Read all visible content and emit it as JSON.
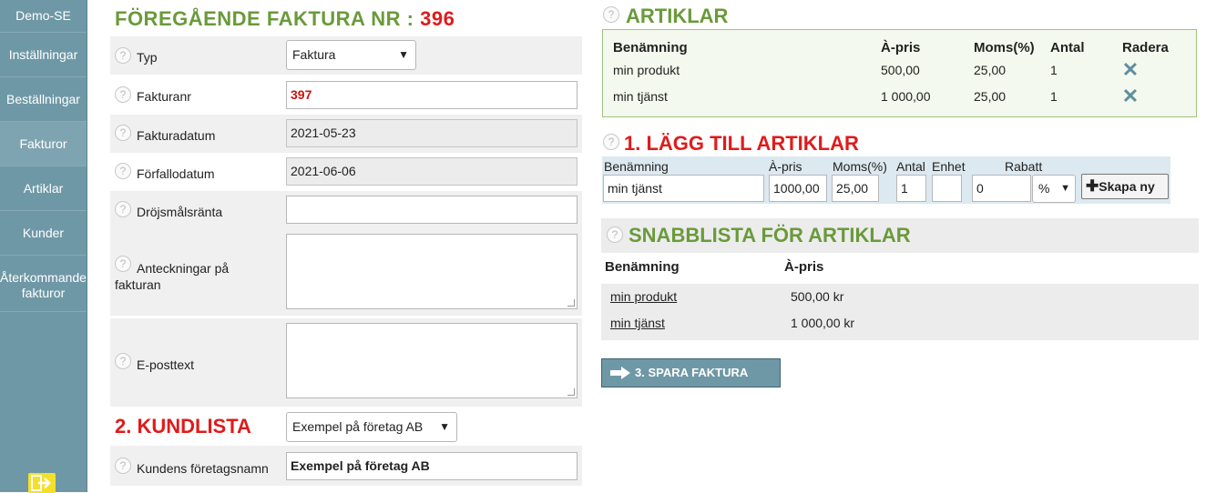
{
  "sidebar": {
    "items": [
      {
        "label": "Demo-SE"
      },
      {
        "label": "Inställningar"
      },
      {
        "label": "Beställningar"
      },
      {
        "label": "Fakturor"
      },
      {
        "label": "Artiklar"
      },
      {
        "label": "Kunder"
      },
      {
        "label": "Återkommande fakturor"
      }
    ],
    "active_index": 3
  },
  "invoice": {
    "heading_prefix": "FÖREGÅENDE FAKTURA NR :",
    "heading_number": "396",
    "help_glyph": "?",
    "fields": {
      "typ": {
        "label": "Typ",
        "value": "Faktura"
      },
      "fakturanr": {
        "label": "Fakturanr",
        "value": "397"
      },
      "fakturadatum": {
        "label": "Fakturadatum",
        "value": "2021-05-23"
      },
      "forfallodatum": {
        "label": "Förfallodatum",
        "value": "2021-06-06"
      },
      "drojsmalsranta": {
        "label": "Dröjsmålsränta",
        "value": ""
      },
      "anteckningar": {
        "label": "Anteckningar på fakturan",
        "value": ""
      },
      "eposttext": {
        "label": "E-posttext",
        "value": ""
      }
    }
  },
  "kundlista": {
    "heading": "2. KUNDLISTA",
    "selected": "Exempel på företag AB",
    "company_label": "Kundens företagsnamn",
    "company_value": "Exempel på företag AB"
  },
  "artiklar": {
    "heading": "ARTIKLAR",
    "columns": {
      "name": "Benämning",
      "price": "À-pris",
      "vat": "Moms(%)",
      "qty": "Antal",
      "delete": "Radera"
    },
    "rows": [
      {
        "name": "min produkt",
        "price": "500,00",
        "vat": "25,00",
        "qty": "1"
      },
      {
        "name": "min tjänst",
        "price": "1 000,00",
        "vat": "25,00",
        "qty": "1"
      }
    ]
  },
  "add_article": {
    "heading": "1. LÄGG TILL ARTIKLAR",
    "labels": {
      "name": "Benämning",
      "price": "À-pris",
      "vat": "Moms(%)",
      "qty": "Antal",
      "unit": "Enhet",
      "discount": "Rabatt"
    },
    "values": {
      "name": "min tjänst",
      "price": "1000,00",
      "vat": "25,00",
      "qty": "1",
      "unit": "",
      "discount": "0",
      "discount_type": "%"
    },
    "create_label": "Skapa ny"
  },
  "quicklist": {
    "heading": "SNABBLISTA FÖR ARTIKLAR",
    "columns": {
      "name": "Benämning",
      "price": "À-pris"
    },
    "rows": [
      {
        "name": "min produkt",
        "price": "500,00 kr"
      },
      {
        "name": "min tjänst",
        "price": "1 000,00 kr"
      }
    ]
  },
  "save": {
    "label": "3. SPARA FAKTURA"
  },
  "icons": {
    "help": "help-circle-icon",
    "delete": "x-icon",
    "add": "plus-icon",
    "save": "arrow-right-icon",
    "logout": "logout-icon",
    "dropdown": "chevron-down-icon"
  },
  "colors": {
    "sidebar": "#6f98a6",
    "heading_green": "#6a9a3a",
    "heading_red": "#e01b1b"
  }
}
